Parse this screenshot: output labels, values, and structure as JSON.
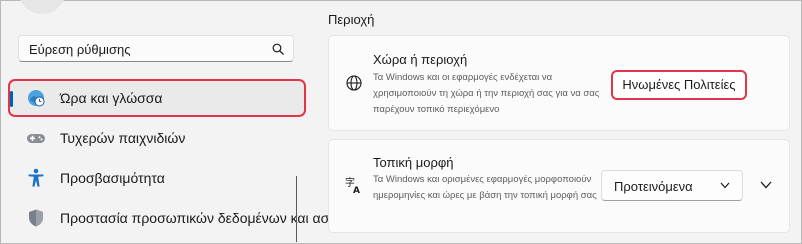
{
  "search": {
    "value": "Εύρεση ρύθμισης"
  },
  "sidebar": {
    "items": [
      {
        "label": "Ώρα και γλώσσα",
        "icon": "time-language-icon",
        "selected": true
      },
      {
        "label": "Τυχερών παιχνιδιών",
        "icon": "gamepad-icon"
      },
      {
        "label": "Προσβασιμότητα",
        "icon": "accessibility-icon"
      },
      {
        "label": "Προστασία προσωπικών δεδομένων και ασφάλεια",
        "icon": "shield-icon"
      }
    ]
  },
  "main": {
    "section_title": "Περιοχή",
    "country_card": {
      "title": "Χώρα ή περιοχή",
      "description": "Τα Windows και οι εφαρμογές ενδέχεται να χρησιμοποιούν τη χώρα ή την περιοχή σας για να σας παρέχουν τοπικό περιεχόμενο",
      "value": "Ηνωμένες Πολιτείες",
      "icon": "globe-icon"
    },
    "format_card": {
      "title": "Τοπική μορφή",
      "description": "Τα Windows και ορισμένες εφαρμογές μορφοποιούν ημερομηνίες και ώρες με βάση την τοπική μορφή σας",
      "value": "Προτεινόμενα",
      "icon": "language-format-icon"
    }
  },
  "colors": {
    "accent": "#005fb8",
    "highlight": "#e2354a"
  }
}
